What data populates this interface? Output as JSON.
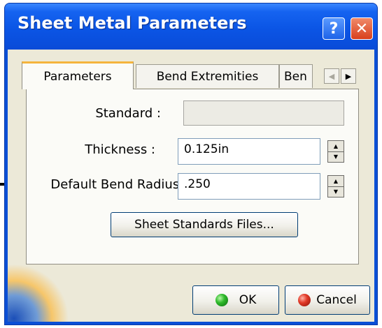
{
  "window": {
    "title": "Sheet Metal Parameters",
    "help_label": "?",
    "close_label": "✕"
  },
  "tabs": [
    {
      "label": "Parameters",
      "active": true
    },
    {
      "label": "Bend Extremities",
      "active": false
    },
    {
      "label": "Ben",
      "active": false
    }
  ],
  "tab_scroll": {
    "left_glyph": "◀",
    "right_glyph": "▶"
  },
  "form": {
    "standard_label": "Standard :",
    "standard_value": "",
    "thickness_label": "Thickness :",
    "thickness_value": "0.125in",
    "radius_label": "Default Bend Radius :",
    "radius_value": ".250",
    "sheet_button_label": "Sheet Standards Files..."
  },
  "spinner": {
    "up_glyph": "▲",
    "down_glyph": "▼"
  },
  "footer": {
    "ok_label": "OK",
    "cancel_label": "Cancel"
  },
  "colors": {
    "title_bar": "#0b55e5",
    "dialog_face": "#ece9d8",
    "active_tab_accent": "#f5b43c",
    "ok_icon": "#2fba2b",
    "cancel_icon": "#e23a28"
  }
}
